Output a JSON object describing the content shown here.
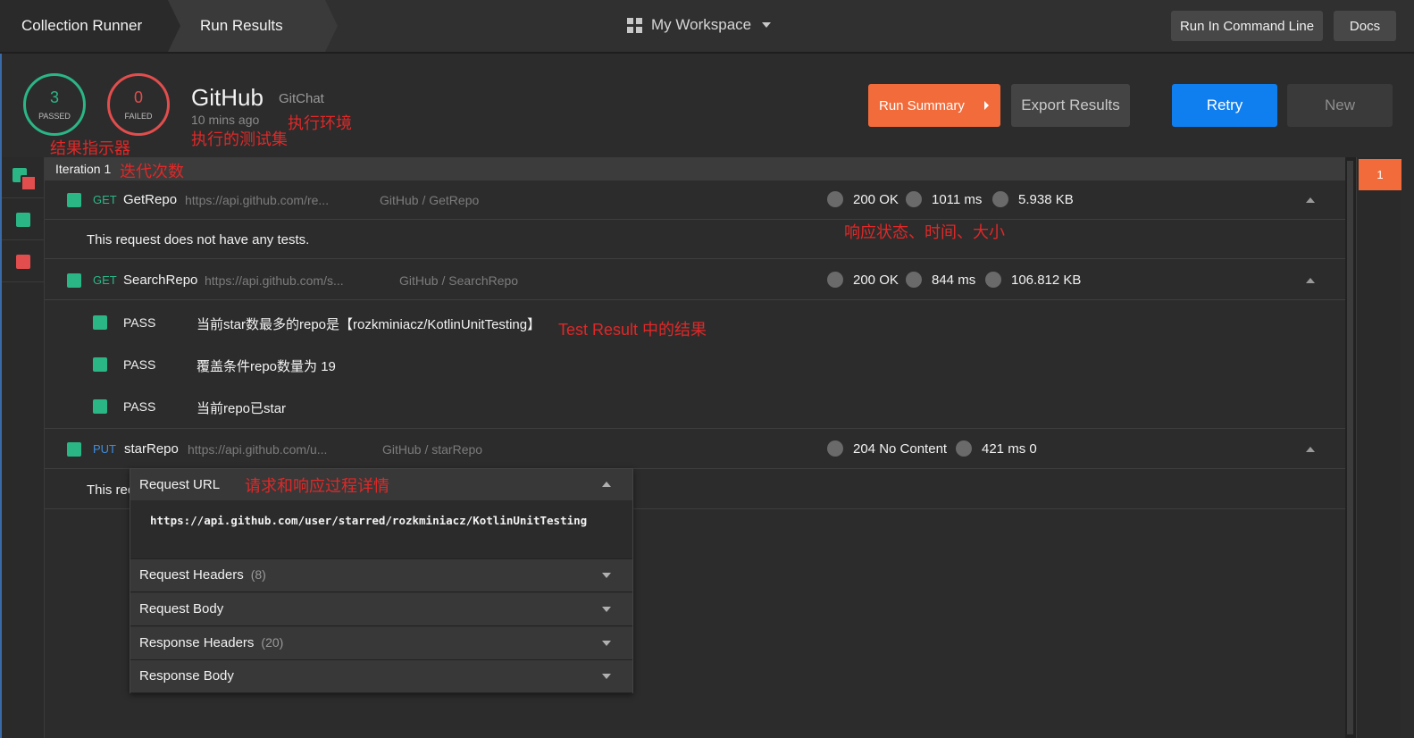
{
  "topbar": {
    "crumb_runner": "Collection Runner",
    "crumb_results": "Run Results",
    "workspace": "My Workspace",
    "run_cli": "Run In Command Line",
    "docs": "Docs"
  },
  "summary": {
    "passed_count": "3",
    "passed_label": "PASSED",
    "failed_count": "0",
    "failed_label": "FAILED",
    "collection": "GitHub",
    "environment": "GitChat",
    "time_ago": "10 mins ago",
    "run_summary": "Run Summary",
    "export": "Export Results",
    "retry": "Retry",
    "new": "New"
  },
  "annotations": {
    "result_indicator": "结果指示器",
    "env": "执行环境",
    "collection": "执行的测试集",
    "iteration": "迭代次数",
    "response_meta": "响应状态、时间、大小",
    "test_result": "Test Result 中的结果",
    "details": "请求和响应过程详情"
  },
  "iteration": {
    "label": "Iteration 1",
    "badge": "1"
  },
  "requests": [
    {
      "method": "GET",
      "name": "GetRepo",
      "url": "https://api.github.com/re...",
      "path": "GitHub / GetRepo",
      "status": "200 OK",
      "time": "1011 ms",
      "size": "5.938 KB",
      "note": "This request does not have any tests."
    },
    {
      "method": "GET",
      "name": "SearchRepo",
      "url": "https://api.github.com/s...",
      "path": "GitHub / SearchRepo",
      "status": "200 OK",
      "time": "844 ms",
      "size": "106.812 KB",
      "tests": [
        {
          "result": "PASS",
          "desc": "当前star数最多的repo是【rozkminiacz/KotlinUnitTesting】"
        },
        {
          "result": "PASS",
          "desc": "覆盖条件repo数量为 19"
        },
        {
          "result": "PASS",
          "desc": "当前repo已star"
        }
      ]
    },
    {
      "method": "PUT",
      "name": "starRepo",
      "url": "https://api.github.com/u...",
      "path": "GitHub / starRepo",
      "status": "204 No Content",
      "time": "421 ms",
      "size": "0",
      "note": "This rec"
    }
  ],
  "details": {
    "request_url_label": "Request URL",
    "request_url": "https://api.github.com/user/starred/rozkminiacz/KotlinUnitTesting",
    "request_headers": "Request Headers",
    "request_headers_count": "(8)",
    "request_body": "Request Body",
    "response_headers": "Response Headers",
    "response_headers_count": "(20)",
    "response_body": "Response Body"
  },
  "colors": {
    "pass": "#2bb686",
    "fail": "#e24d4d",
    "accent_orange": "#f26b3a",
    "accent_blue": "#0f7ff0",
    "annotation_red": "#e02828"
  }
}
